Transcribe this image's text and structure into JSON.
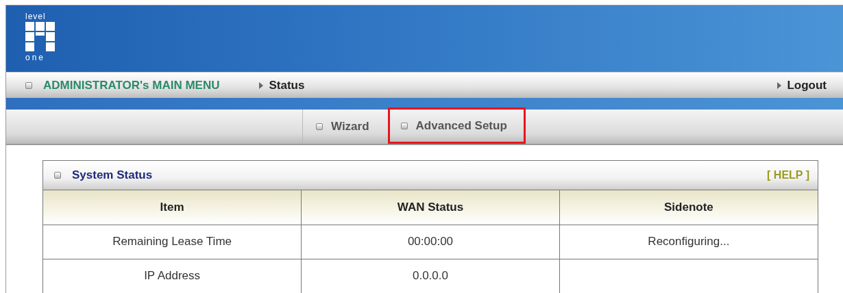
{
  "logo": {
    "top_text": "level",
    "bottom_text": "one"
  },
  "menu_bar": {
    "title": "ADMINISTRATOR's MAIN MENU",
    "current": "Status",
    "logout": "Logout"
  },
  "tabs": [
    {
      "label": "Wizard",
      "selected": false,
      "highlighted": false
    },
    {
      "label": "Advanced Setup",
      "selected": false,
      "highlighted": true
    }
  ],
  "panel": {
    "title": "System Status",
    "help": "[ HELP ]"
  },
  "table": {
    "columns": [
      "Item",
      "WAN Status",
      "Sidenote"
    ],
    "rows": [
      [
        "Remaining Lease Time",
        "00:00:00",
        "Reconfiguring..."
      ],
      [
        "IP Address",
        "0.0.0.0",
        ""
      ]
    ]
  }
}
